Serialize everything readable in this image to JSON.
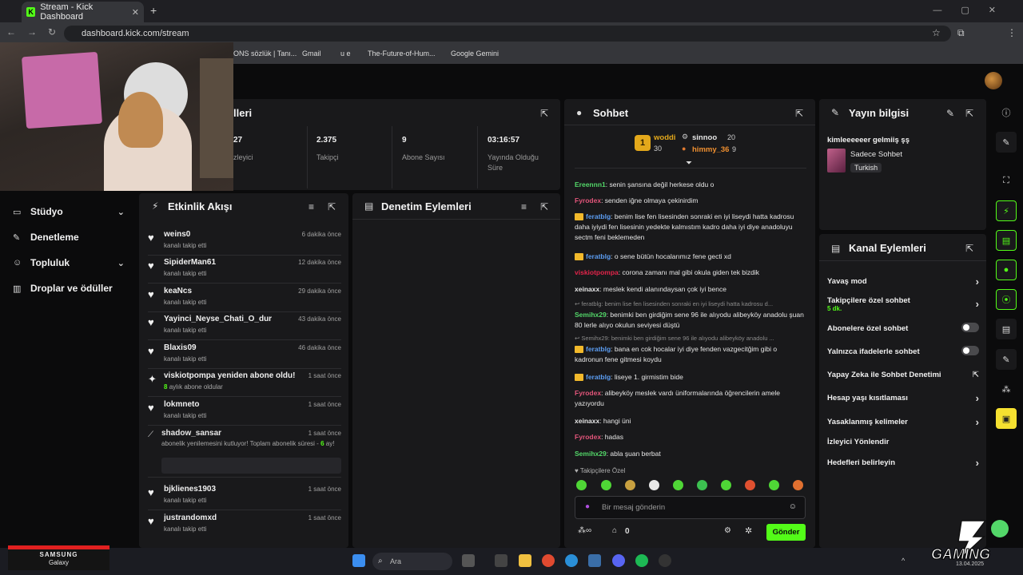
{
  "browser": {
    "tab_title": "Stream - Kick Dashboard",
    "url": "dashboard.kick.com/stream",
    "bookmarks": [
      "ONS sözlük | Tanı...",
      "Gmail",
      "u e",
      "The-Future-of-Hum...",
      "Google Gemini"
    ]
  },
  "sidebar": {
    "items": [
      {
        "label": "Stüdyo",
        "icon": "monitor-icon",
        "has_chevron": true
      },
      {
        "label": "Denetleme",
        "icon": "wrench-icon",
        "has_chevron": false
      },
      {
        "label": "Topluluk",
        "icon": "people-icon",
        "has_chevron": true
      },
      {
        "label": "Droplar ve ödüller",
        "icon": "chart-icon",
        "has_chevron": false
      }
    ]
  },
  "stats": {
    "title": "lleri",
    "items": [
      {
        "value": "27",
        "label": "zleyici"
      },
      {
        "value": "2.375",
        "label": "Takipçi"
      },
      {
        "value": "9",
        "label": "Abone Sayısı"
      },
      {
        "value": "03:16:57",
        "label": "Yayında Olduğu Süre"
      }
    ]
  },
  "activity": {
    "title": "Etkinlik Akışı",
    "events": [
      {
        "name": "weins0",
        "sub": "kanalı takip etti",
        "time": "6 dakika önce",
        "icon": "heart-icon"
      },
      {
        "name": "SipiderMan61",
        "sub": "kanalı takip etti",
        "time": "12 dakika önce",
        "icon": "heart-icon"
      },
      {
        "name": "keaNcs",
        "sub": "kanalı takip etti",
        "time": "29 dakika önce",
        "icon": "heart-icon"
      },
      {
        "name": "Yayinci_Neyse_Chati_O_dur",
        "sub": "kanalı takip etti",
        "time": "43 dakika önce",
        "icon": "heart-icon"
      },
      {
        "name": "Blaxis09",
        "sub": "kanalı takip etti",
        "time": "46 dakika önce",
        "icon": "heart-icon"
      },
      {
        "name": "viskiotpompa yeniden abone oldu!",
        "sub_highlight": "8",
        "sub": "aylık abone oldular",
        "time": "1 saat önce",
        "icon": "sparkle-icon"
      },
      {
        "name": "lokmneto",
        "sub": "kanalı takip etti",
        "time": "1 saat önce",
        "icon": "heart-icon"
      }
    ],
    "resub": {
      "name": "shadow_sansar",
      "text": "abonelik yenilemesini kutluyor! Toplam abonelik süresi -",
      "highlight": "6",
      "text2": "ay!",
      "time": "1 saat önce"
    },
    "events2": [
      {
        "name": "bjklienes1903",
        "sub": "kanalı takip etti",
        "time": "1 saat önce"
      },
      {
        "name": "justrandomxd",
        "sub": "kanalı takip etti",
        "time": "1 saat önce"
      }
    ]
  },
  "moderation": {
    "title": "Denetim Eylemleri"
  },
  "chat": {
    "title": "Sohbet",
    "leaderboard": [
      {
        "rank": "1",
        "name": "woddi",
        "count": "30"
      },
      {
        "name": "sinnoo",
        "count": "20"
      },
      {
        "name": "himmy_36",
        "count": "9"
      }
    ],
    "messages": [
      {
        "user": "Ereennn1",
        "color": "#53d769",
        "text": ": senin şansına değil herkese oldu o"
      },
      {
        "user": "Fyrodex",
        "color": "#e2557a",
        "text": ": senden iğne olmaya çekinirdim"
      },
      {
        "user": "feratblg",
        "color": "#5b9cf0",
        "text": ": benim lise fen lisesinden sonraki en iyi liseydi hatta kadrosu daha iyiydi fen lisesinin yedekte kalmıstım kadro daha iyi diye anadoluyu sectm feni beklemeden",
        "badge": true
      },
      {
        "user": "feratblg",
        "color": "#5b9cf0",
        "text": ": o sene bütün hocalarımız fene gecti xd",
        "badge": true
      },
      {
        "user": "viskiotpompa",
        "color": "#e2244a",
        "text": ": corona zamanı mal gibi okula giden tek bizdik"
      },
      {
        "user": "xeinaxx",
        "color": "#e6e6e6",
        "text": ": meslek kendi alanındaysan çok iyi bence"
      },
      {
        "reply": "feratblg: benim lise fen lisesinden sonraki en iyi liseydi hatta kadrosu d..."
      },
      {
        "user": "Semihx29",
        "color": "#53d769",
        "text": ": benimki ben girdiğim sene 96 ile alıyodu alibeyköy anadolu şuan 80 lerle alıyo okulun seviyesi düştü"
      },
      {
        "reply": "Semihx29: benimki ben girdiğim sene 96 ile alıyodu alibeyköy anadolu ..."
      },
      {
        "user": "feratblg",
        "color": "#5b9cf0",
        "text": ": bana en cok hocalar iyi diye fenden vazgecitğim gibi o kadronun fene gitmesi koydu",
        "badge": true
      },
      {
        "user": "feratblg",
        "color": "#5b9cf0",
        "text": ": liseye 1. girmistim bide",
        "badge": true
      },
      {
        "user": "Fyrodex",
        "color": "#e2557a",
        "text": ": alibeyköy meslek vardı üniformalarında öğrencilerin amele yazıyordu"
      },
      {
        "user": "xeinaxx",
        "color": "#e6e6e6",
        "text": ": hangi üni"
      },
      {
        "user": "Fyrodex",
        "color": "#e2557a",
        "text": ": hadas"
      },
      {
        "user": "Semihx29",
        "color": "#53d769",
        "text": ": abla şuan berbat"
      }
    ],
    "followers_only": "Takipçilere Özel",
    "input_placeholder": "Bir mesaj gönderin",
    "count": "0",
    "send_label": "Gönder"
  },
  "stream_info": {
    "title": "Yayın bilgisi",
    "stream_title": "kimleeeeeer gelmiiş şş",
    "category": "Sadece Sohbet",
    "tag": "Turkish"
  },
  "channel_actions": {
    "title": "Kanal Eylemleri",
    "items": [
      {
        "label": "Yavaş mod",
        "control": "arrow"
      },
      {
        "label": "Takipçilere özel sohbet",
        "sub": "5 dk.",
        "control": "arrow"
      },
      {
        "label": "Abonelere özel sohbet",
        "control": "toggle"
      },
      {
        "label": "Yalnızca ifadelerle sohbet",
        "control": "toggle"
      },
      {
        "label": "Yapay Zeka ile Sohbet Denetimi",
        "control": "external"
      },
      {
        "label": "Hesap yaşı kısıtlaması",
        "control": "arrow"
      },
      {
        "label": "Yasaklanmış kelimeler",
        "control": "arrow"
      },
      {
        "label": "İzleyici Yönlendir",
        "control": "none"
      },
      {
        "label": "Hedefleri belirleyin",
        "control": "arrow"
      }
    ]
  },
  "overlay": {
    "samsung_line1": "SAMSUNG",
    "samsung_line2": "Galaxy",
    "gaming_text": "GAMING"
  },
  "taskbar": {
    "search_placeholder": "Ara",
    "clock": "13.04.2025"
  },
  "colors": {
    "accent": "#53fc18",
    "panel": "#19191b",
    "bg": "#0b0b0c"
  }
}
